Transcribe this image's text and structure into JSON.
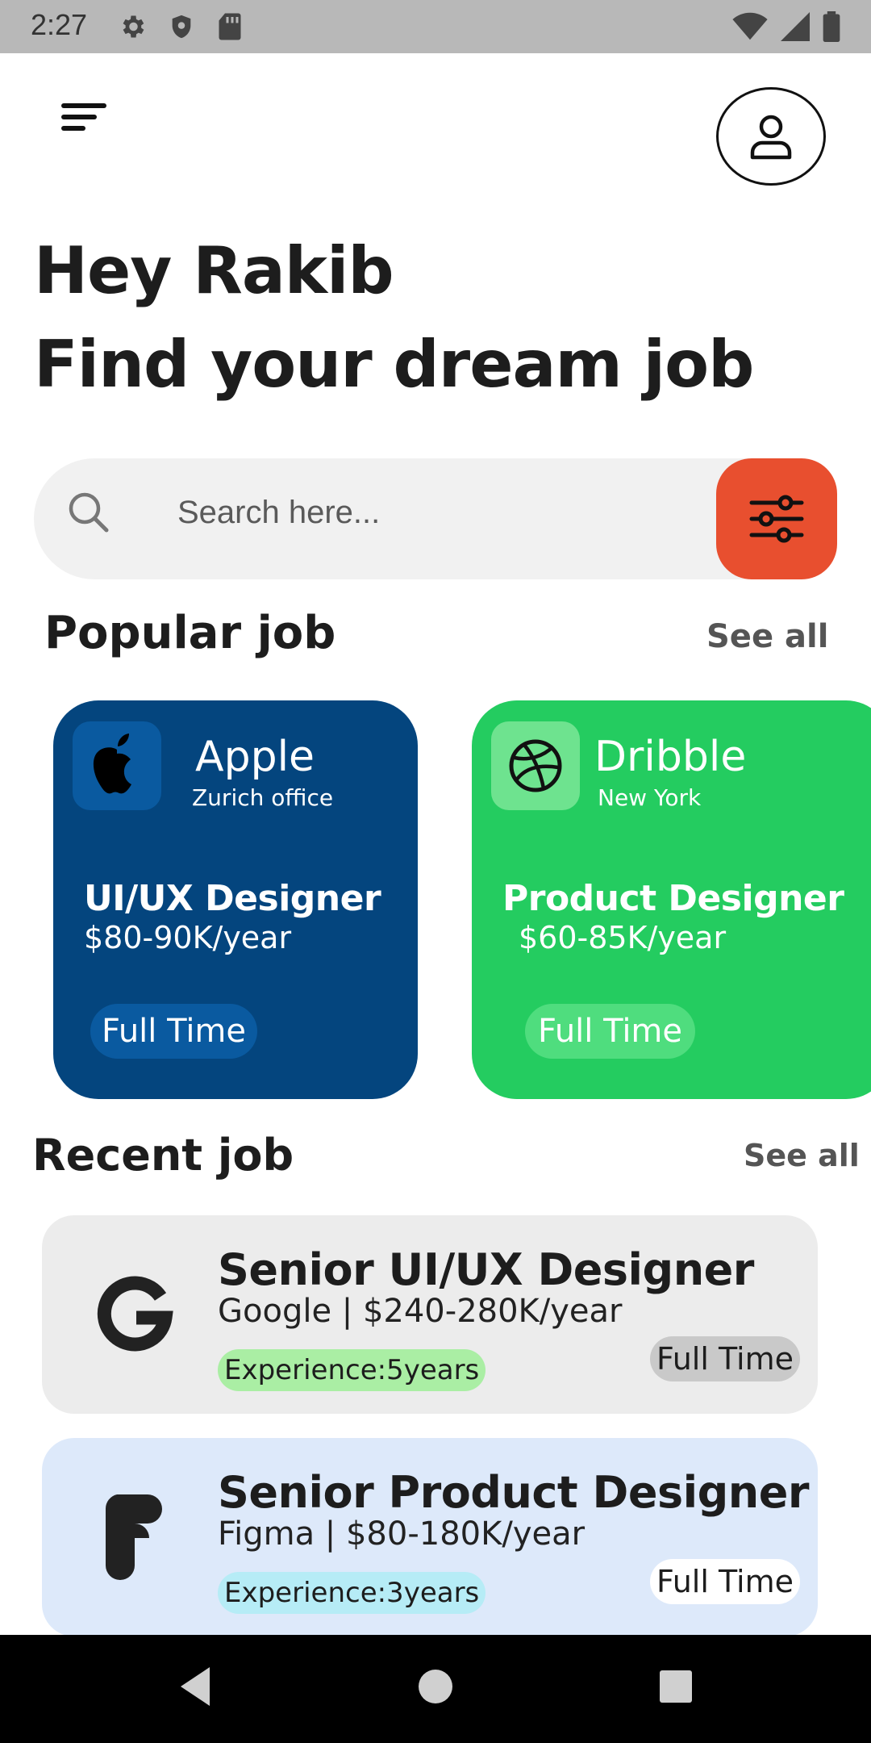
{
  "status_bar": {
    "time": "2:27",
    "icons_left": [
      "gear-icon",
      "shield-icon",
      "sd-card-icon"
    ],
    "icons_right": [
      "wifi-icon",
      "signal-icon",
      "battery-icon"
    ]
  },
  "header": {
    "menu_icon": "menu-icon",
    "profile_icon": "user-icon"
  },
  "greeting": "Hey Rakib",
  "headline": "Find your dream job",
  "search": {
    "placeholder": "Search here...",
    "filter_icon": "sliders-icon",
    "filter_color": "#e84f2f"
  },
  "popular": {
    "title": "Popular job",
    "see_all": "See all",
    "cards": [
      {
        "company": "Apple",
        "location": "Zurich office",
        "role": "UI/UX Designer",
        "salary": "$80-90K/year",
        "type": "Full Time",
        "color": "#04457e",
        "logo": "apple-icon"
      },
      {
        "company": "Dribble",
        "location": "New York",
        "role": "Product Designer",
        "salary": "$60-85K/year",
        "type": "Full Time",
        "color": "#24cc60",
        "logo": "dribbble-icon"
      }
    ]
  },
  "recent": {
    "title": "Recent job",
    "see_all": "See all",
    "items": [
      {
        "title": "Senior UI/UX Designer",
        "subtitle": "Google | $240-280K/year",
        "experience": "Experience:5years",
        "type": "Full Time",
        "logo": "google-icon",
        "color": "#ececec"
      },
      {
        "title": "Senior Product Designer",
        "subtitle": "Figma | $80-180K/year",
        "experience": "Experience:3years",
        "type": "Full Time",
        "logo": "figma-icon",
        "color": "#dde9fa"
      }
    ]
  },
  "nav_bar": {
    "back_icon": "back-icon",
    "home_icon": "home-icon",
    "recents_icon": "recents-icon"
  }
}
